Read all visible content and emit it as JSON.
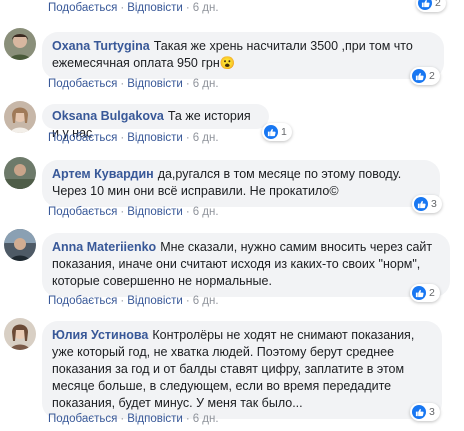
{
  "action_labels": {
    "like": "Подобається",
    "reply": "Відповісти"
  },
  "comments": [
    {
      "author": "",
      "text": "",
      "time": "6 дн.",
      "reactions": "2"
    },
    {
      "author": "Oxana Turtygina",
      "text": "Такая же хрень насчитали 3500 ,при том что ежемесячная оплата 950 грн😮",
      "time": "6 дн.",
      "reactions": "2"
    },
    {
      "author": "Oksana Bulgakova",
      "text": "Та же история и у нас",
      "time": "6 дн.",
      "reactions": "1"
    },
    {
      "author": "Артем Кувардин",
      "text": "да,ругался в том месяце по этому поводу. Через 10 мин они всё исправили. Не прокатило©",
      "time": "6 дн.",
      "reactions": "3"
    },
    {
      "author": "Anna Materiienko",
      "text": "Мне сказали, нужно самим вносить через сайт показания, иначе они считают исходя из каких-то своих \"норм\", которые совершенно не нормальные.",
      "time": "6 дн.",
      "reactions": "2"
    },
    {
      "author": "Юлия Устинова",
      "text": "Контролёры не ходят не снимают показания, уже который год, не хватка людей. Поэтому берут среднее показания за год и от балды ставят цифру, заплатите в этом месяце больше, в следующем, если во время передадите показания, будет минус. У меня так было...",
      "time": "6 дн.",
      "reactions": "3"
    }
  ]
}
